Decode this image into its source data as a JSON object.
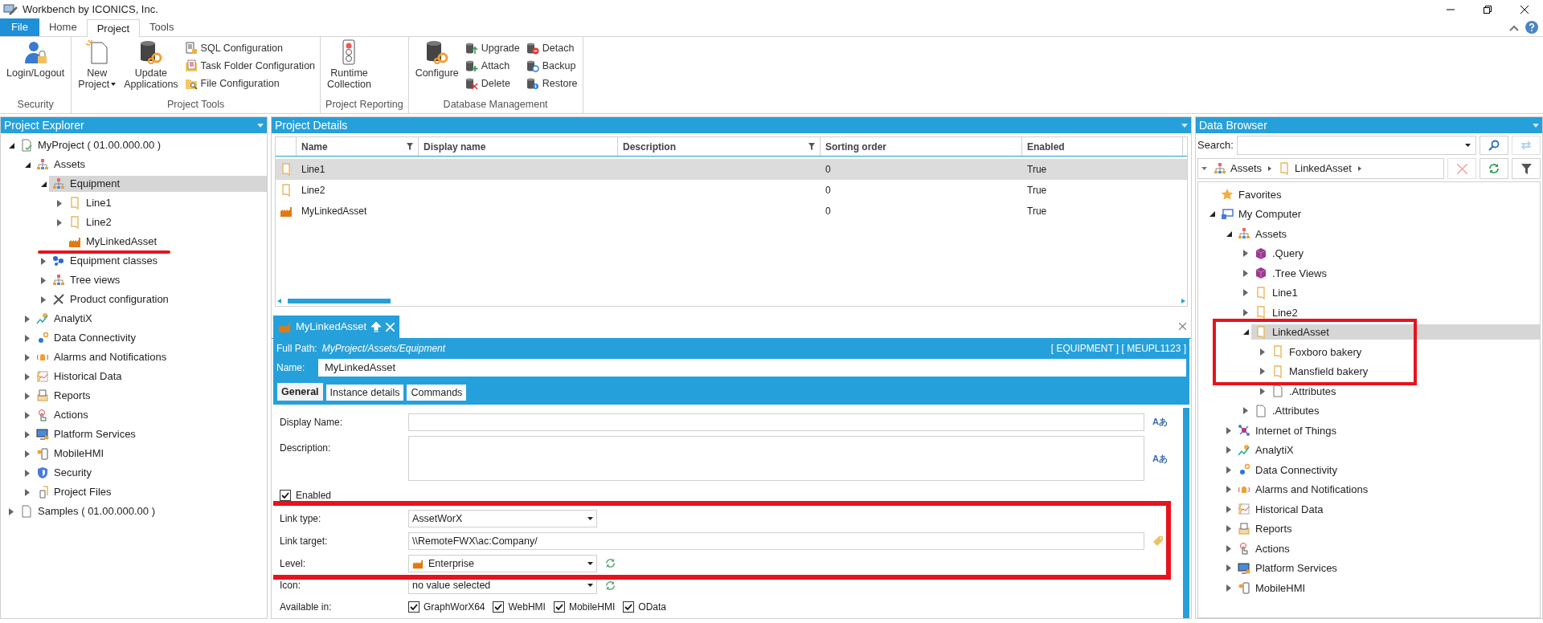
{
  "window": {
    "title": "Workbench by ICONICS, Inc."
  },
  "ribbon": {
    "tabs": [
      {
        "label": "File",
        "kind": "file",
        "selected": false
      },
      {
        "label": "Home",
        "kind": "tab",
        "selected": false
      },
      {
        "label": "Project",
        "kind": "tab",
        "selected": true
      },
      {
        "label": "Tools",
        "kind": "tab",
        "selected": false
      }
    ],
    "groups": [
      {
        "label": "Security",
        "large": [
          {
            "label": "Login/Logout",
            "kind": "userlock",
            "dropdown": false
          }
        ]
      },
      {
        "label": "Project Tools",
        "large": [
          {
            "label": "New Project",
            "kind": "newdoc",
            "dropdown": true
          },
          {
            "label": "Update Applications",
            "kind": "dbgear",
            "dropdown": false
          }
        ],
        "small": [
          {
            "label": "SQL Configuration",
            "kind": "sqldoc"
          },
          {
            "label": "Task Folder Configuration",
            "kind": "taskfolder"
          },
          {
            "label": "File Configuration",
            "kind": "fileconfig"
          }
        ]
      },
      {
        "label": "Project Reporting",
        "large": [
          {
            "label": "Runtime Collection",
            "kind": "traffic",
            "dropdown": false
          }
        ]
      },
      {
        "label": "Database Management",
        "large": [
          {
            "label": "Configure",
            "kind": "dbgear",
            "dropdown": false
          }
        ],
        "small": [
          {
            "label": "Upgrade",
            "kind": "dbup"
          },
          {
            "label": "Attach",
            "kind": "dbplus"
          },
          {
            "label": "Delete",
            "kind": "dbx"
          },
          {
            "label": "Detach",
            "kind": "dbminus"
          },
          {
            "label": "Backup",
            "kind": "dbbackup"
          },
          {
            "label": "Restore",
            "kind": "dbrestore"
          }
        ]
      }
    ]
  },
  "project_explorer": {
    "title": "Project Explorer",
    "tree": [
      {
        "label": "MyProject ( 01.00.000.00 )",
        "kind": "project",
        "expanded": true,
        "selected": false,
        "children": [
          {
            "label": "Assets",
            "kind": "hierarchy",
            "expanded": true,
            "selected": false,
            "children": [
              {
                "label": "Equipment",
                "kind": "hierarchy",
                "expanded": true,
                "selected": true,
                "children": [
                  {
                    "label": "Line1",
                    "kind": "folder",
                    "expanded": false,
                    "selected": false
                  },
                  {
                    "label": "Line2",
                    "kind": "folder",
                    "expanded": false,
                    "selected": false
                  },
                  {
                    "label": "MyLinkedAsset",
                    "kind": "factory",
                    "selected": false
                  }
                ]
              },
              {
                "label": "Equipment classes",
                "kind": "nodes",
                "expanded": false,
                "selected": false
              },
              {
                "label": "Tree views",
                "kind": "hierarchy",
                "expanded": false,
                "selected": false
              },
              {
                "label": "Product configuration",
                "kind": "wrench",
                "expanded": false,
                "selected": false
              }
            ]
          },
          {
            "label": "AnalytiX",
            "kind": "chart",
            "expanded": false,
            "selected": false
          },
          {
            "label": "Data Connectivity",
            "kind": "gear",
            "expanded": false,
            "selected": false
          },
          {
            "label": "Alarms and Notifications",
            "kind": "bell",
            "expanded": false,
            "selected": false
          },
          {
            "label": "Historical Data",
            "kind": "historical",
            "expanded": false,
            "selected": false
          },
          {
            "label": "Reports",
            "kind": "report",
            "expanded": false,
            "selected": false
          },
          {
            "label": "Actions",
            "kind": "hand",
            "expanded": false,
            "selected": false
          },
          {
            "label": "Platform Services",
            "kind": "monitor",
            "expanded": false,
            "selected": false
          },
          {
            "label": "MobileHMI",
            "kind": "phone",
            "expanded": false,
            "selected": false
          },
          {
            "label": "Security",
            "kind": "shield",
            "expanded": false,
            "selected": false
          },
          {
            "label": "Project Files",
            "kind": "files",
            "expanded": false,
            "selected": false
          }
        ]
      },
      {
        "label": "Samples ( 01.00.000.00 )",
        "kind": "doc",
        "expanded": false,
        "selected": false
      }
    ]
  },
  "project_details": {
    "title": "Project Details",
    "columns": [
      {
        "label": "Name",
        "filter": true
      },
      {
        "label": "Display name",
        "filter": false
      },
      {
        "label": "Description",
        "filter": true
      },
      {
        "label": "Sorting order",
        "filter": false
      },
      {
        "label": "Enabled",
        "filter": false
      }
    ],
    "rows": [
      {
        "kind": "folder",
        "name": "Line1",
        "sorting_order": "0",
        "enabled": "True",
        "selected": true
      },
      {
        "kind": "folder",
        "name": "Line2",
        "sorting_order": "0",
        "enabled": "True",
        "selected": false
      },
      {
        "kind": "factory",
        "name": "MyLinkedAsset",
        "sorting_order": "0",
        "enabled": "True",
        "selected": false
      }
    ]
  },
  "editor": {
    "tab": {
      "label": "MyLinkedAsset",
      "kind": "factory"
    },
    "full_path_label": "Full Path:",
    "full_path": "MyProject/Assets/Equipment",
    "tags": "[ EQUIPMENT ] [ MEUPL1123 ]",
    "name_label": "Name:",
    "name_value": "MyLinkedAsset",
    "tabs": [
      {
        "label": "General",
        "selected": true
      },
      {
        "label": "Instance details",
        "selected": false
      },
      {
        "label": "Commands",
        "selected": false
      }
    ],
    "fields": [
      {
        "kind": "text",
        "label": "Display Name:",
        "side": {
          "kind": "translate",
          "label": "Aあ"
        }
      },
      {
        "kind": "textarea",
        "label": "Description:",
        "side": {
          "kind": "translate",
          "label": "Aあ"
        }
      },
      {
        "kind": "checkbox",
        "label": "Enabled",
        "checked": true
      },
      {
        "kind": "dropdown",
        "label": "Link type:",
        "value": "AssetWorX"
      },
      {
        "kind": "text",
        "label": "Link target:",
        "value": "\\\\RemoteFWX\\ac:Company/",
        "side": {
          "kind": "tag"
        }
      },
      {
        "kind": "dropdown",
        "label": "Level:",
        "value": "Enterprise",
        "value_icon": true,
        "side": {
          "kind": "refresh"
        }
      },
      {
        "kind": "dropdown",
        "label": "Icon:",
        "value": "no value selected",
        "side": {
          "kind": "refresh"
        }
      },
      {
        "kind": "checkgroup",
        "label": "Available in:",
        "options": [
          {
            "label": "GraphWorX64",
            "checked": true
          },
          {
            "label": "WebHMI",
            "checked": true
          },
          {
            "label": "MobileHMI",
            "checked": true
          },
          {
            "label": "OData",
            "checked": true
          }
        ]
      }
    ]
  },
  "data_browser": {
    "title": "Data Browser",
    "search_label": "Search:",
    "breadcrumb": [
      {
        "label": "Assets",
        "kind": "hierarchy"
      },
      {
        "label": "LinkedAsset",
        "kind": "folder"
      }
    ],
    "tree": [
      {
        "label": "Favorites",
        "kind": "star",
        "selected": false
      },
      {
        "label": "My Computer",
        "kind": "computer",
        "expanded": true,
        "selected": false,
        "children": [
          {
            "label": "Assets",
            "kind": "hierarchy",
            "expanded": true,
            "selected": false,
            "children": [
              {
                "label": ".Query",
                "kind": "cube",
                "expanded": false,
                "selected": false
              },
              {
                "label": ".Tree Views",
                "kind": "cube",
                "expanded": false,
                "selected": false
              },
              {
                "label": "Line1",
                "kind": "folder",
                "expanded": false,
                "selected": false
              },
              {
                "label": "Line2",
                "kind": "folder",
                "expanded": false,
                "selected": false
              },
              {
                "label": "LinkedAsset",
                "kind": "folder",
                "expanded": true,
                "selected": true,
                "children": [
                  {
                    "label": "Foxboro bakery",
                    "kind": "folder",
                    "expanded": false,
                    "selected": false
                  },
                  {
                    "label": "Mansfield bakery",
                    "kind": "folder",
                    "expanded": false,
                    "selected": false
                  },
                  {
                    "label": ".Attributes",
                    "kind": "doc",
                    "expanded": false,
                    "selected": false
                  }
                ]
              },
              {
                "label": ".Attributes",
                "kind": "doc",
                "expanded": false,
                "selected": false
              }
            ]
          },
          {
            "label": "Internet of Things",
            "kind": "iot",
            "expanded": false,
            "selected": false
          },
          {
            "label": "AnalytiX",
            "kind": "chart",
            "expanded": false,
            "selected": false
          },
          {
            "label": "Data Connectivity",
            "kind": "gear",
            "expanded": false,
            "selected": false
          },
          {
            "label": "Alarms and Notifications",
            "kind": "bell",
            "expanded": false,
            "selected": false
          },
          {
            "label": "Historical Data",
            "kind": "historical",
            "expanded": false,
            "selected": false
          },
          {
            "label": "Reports",
            "kind": "report",
            "expanded": false,
            "selected": false
          },
          {
            "label": "Actions",
            "kind": "hand",
            "expanded": false,
            "selected": false
          },
          {
            "label": "Platform Services",
            "kind": "monitor",
            "expanded": false,
            "selected": false
          },
          {
            "label": "MobileHMI",
            "kind": "phone",
            "expanded": false,
            "selected": false
          }
        ]
      }
    ]
  }
}
